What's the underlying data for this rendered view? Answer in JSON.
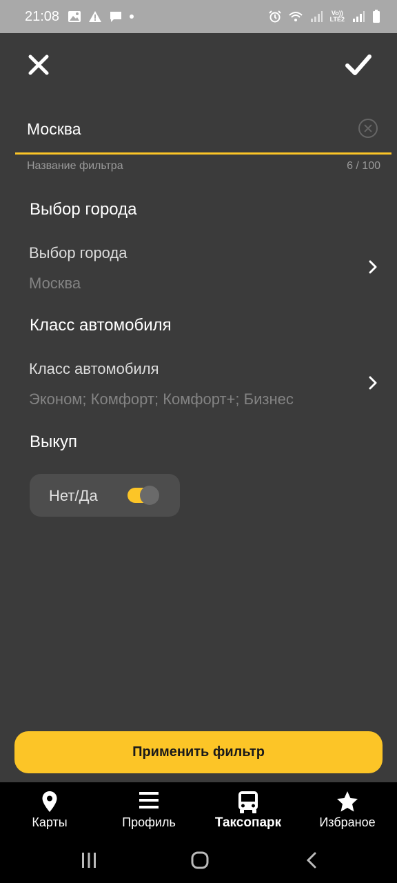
{
  "status_bar": {
    "time": "21:08",
    "left_icons": [
      "image-icon",
      "alert-icon",
      "message-icon",
      "dot-icon"
    ],
    "right_icons": [
      "alarm-icon",
      "wifi-icon",
      "signal-icon",
      "lte-icon",
      "signal-icon",
      "battery-icon"
    ],
    "lte_label_top": "Vo))",
    "lte_label_bottom": "LTE2"
  },
  "header": {
    "close_icon": "close-icon",
    "confirm_icon": "checkmark-icon"
  },
  "filter_name": {
    "value": "Москва",
    "helper": "Название фильтра",
    "counter": "6 / 100"
  },
  "city_section": {
    "title": "Выбор города",
    "label": "Выбор города",
    "value": "Москва"
  },
  "car_class_section": {
    "title": "Класс автомобиля",
    "label": "Класс автомобиля",
    "value": "Эконом; Комфорт; Комфорт+; Бизнес"
  },
  "buyout_section": {
    "title": "Выкуп",
    "toggle_label": "Нет/Да",
    "toggle_on": true
  },
  "apply_button": {
    "label": "Применить фильтр"
  },
  "bottom_nav": {
    "items": [
      {
        "label": "Карты",
        "icon": "map-pin-icon",
        "active": false
      },
      {
        "label": "Профиль",
        "icon": "menu-icon",
        "active": false
      },
      {
        "label": "Таксопарк",
        "icon": "bus-icon",
        "active": true
      },
      {
        "label": "Избраное",
        "icon": "star-icon",
        "active": false
      }
    ]
  },
  "colors": {
    "background": "#3b3b3b",
    "accent": "#fcc527",
    "status_bar": "#a9a9a9",
    "nav_background": "#000000"
  }
}
